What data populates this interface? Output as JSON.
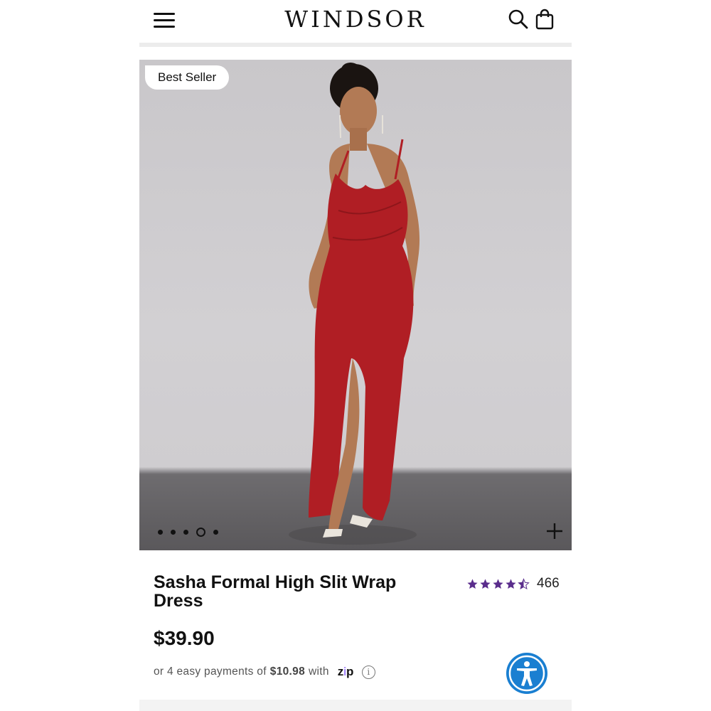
{
  "header": {
    "logo_text": "WINDSOR",
    "menu_icon": "hamburger-menu-icon",
    "search_icon": "search-icon",
    "bag_icon": "shopping-bag-icon"
  },
  "hero": {
    "badge": "Best Seller",
    "carousel_count": 5,
    "carousel_active_index": 3,
    "zoom_icon": "plus-icon"
  },
  "product": {
    "title": "Sasha Formal High Slit Wrap Dress",
    "rating_value": 4.5,
    "rating_count": "466",
    "price": "$39.90",
    "payments_prefix": "or 4 easy payments of",
    "payments_amount": "$10.98",
    "payments_with": "with",
    "zip_text": "zip",
    "info_icon": "info-icon"
  },
  "accessibility_icon": "accessibility-icon",
  "colors": {
    "star": "#5a2d8c",
    "accessibility_button": "#1a7fd1",
    "dress": "#b01e24",
    "backdrop": "#cdcbce"
  }
}
